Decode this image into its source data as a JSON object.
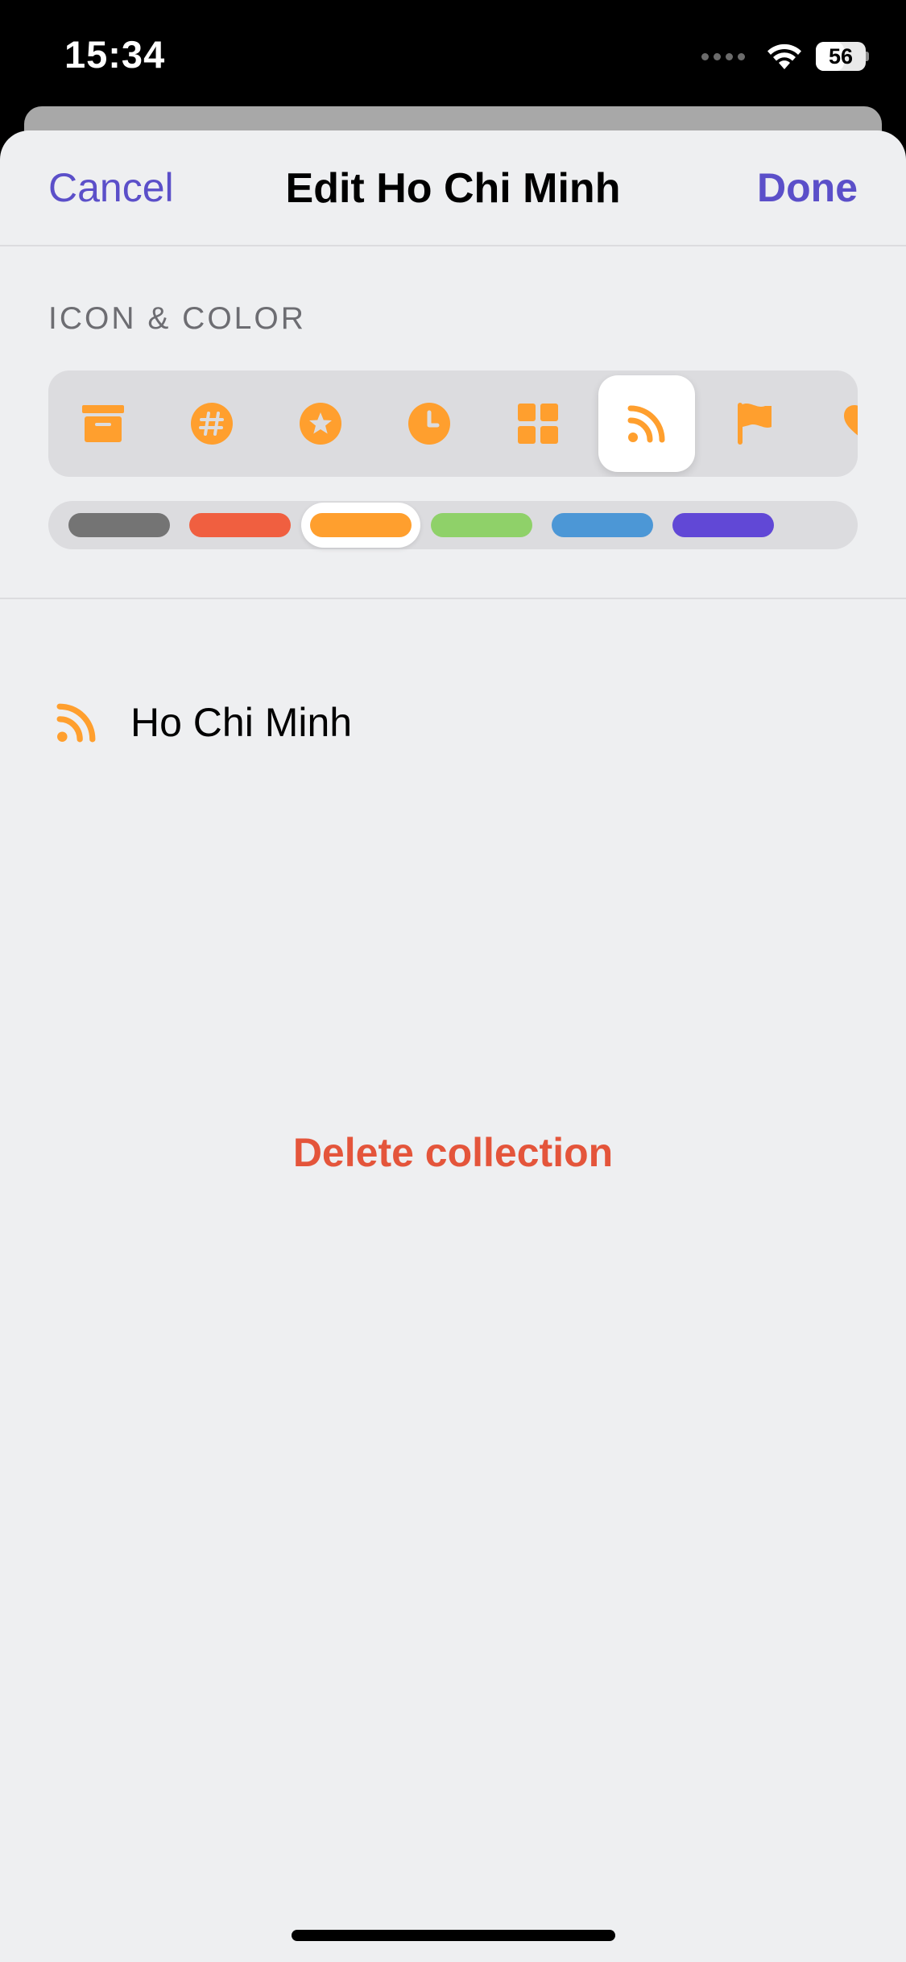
{
  "status_bar": {
    "time": "15:34",
    "battery_level": "56",
    "battery_fraction": 0.56
  },
  "nav": {
    "cancel_label": "Cancel",
    "title": "Edit Ho Chi Minh",
    "done_label": "Done"
  },
  "section": {
    "header": "ICON & COLOR"
  },
  "icons": {
    "items": [
      "archive-icon",
      "hashtag-icon",
      "star-icon",
      "clock-icon",
      "grid-icon",
      "rss-icon",
      "flag-icon",
      "heart-icon"
    ],
    "selected": "rss-icon"
  },
  "colors": {
    "items": [
      "#747474",
      "#f05f40",
      "#ff9f2e",
      "#8fd169",
      "#4c97d6",
      "#6148d6"
    ],
    "selected": "#ff9f2e"
  },
  "preview": {
    "label": "Ho Chi Minh",
    "icon": "rss-icon"
  },
  "actions": {
    "delete_label": "Delete collection"
  },
  "theme": {
    "accent": "#5b4fc9",
    "icon_color": "#ff9f2e",
    "destructive": "#e4553b"
  }
}
